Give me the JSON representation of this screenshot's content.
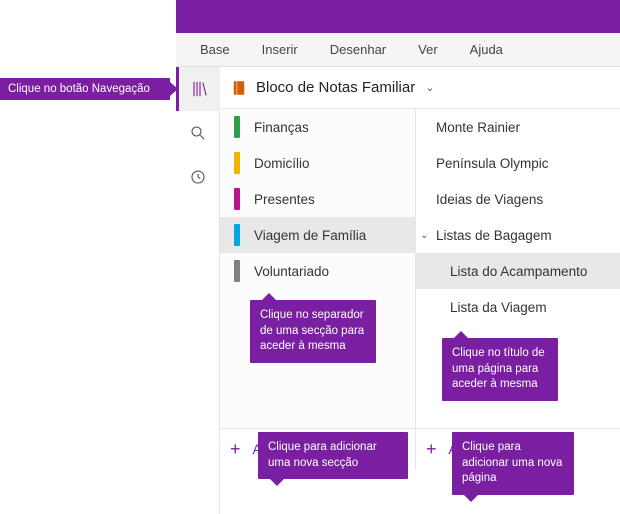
{
  "callouts": {
    "nav": "Clique no botão Navegação",
    "section": "Clique no separador de uma secção para aceder à mesma",
    "page": "Clique no título de uma página para aceder à mesma",
    "add_section": "Clique para adicionar uma nova secção",
    "add_page": "Clique para adicionar uma nova página"
  },
  "ribbon": {
    "base": "Base",
    "inserir": "Inserir",
    "desenhar": "Desenhar",
    "ver": "Ver",
    "ajuda": "Ajuda"
  },
  "notebook": {
    "title": "Bloco de Notas Familiar"
  },
  "sections": {
    "items": [
      {
        "label": "Finanças",
        "color": "#2e9e4a"
      },
      {
        "label": "Domicílio",
        "color": "#f0b400"
      },
      {
        "label": "Presentes",
        "color": "#b8158c"
      },
      {
        "label": "Viagem de Família",
        "color": "#00a6e0"
      },
      {
        "label": "Voluntariado",
        "color": "#808080"
      }
    ],
    "add": "Adicionar secção"
  },
  "pages": {
    "items": [
      {
        "label": "Monte Rainier"
      },
      {
        "label": "Península Olympic"
      },
      {
        "label": "Ideias de Viagens"
      },
      {
        "label": "Listas de Bagagem"
      },
      {
        "label": "Lista do Acampamento"
      },
      {
        "label": "Lista da Viagem"
      }
    ],
    "add": "Adicionar página"
  },
  "colors": {
    "accent": "#7b1fa2"
  }
}
